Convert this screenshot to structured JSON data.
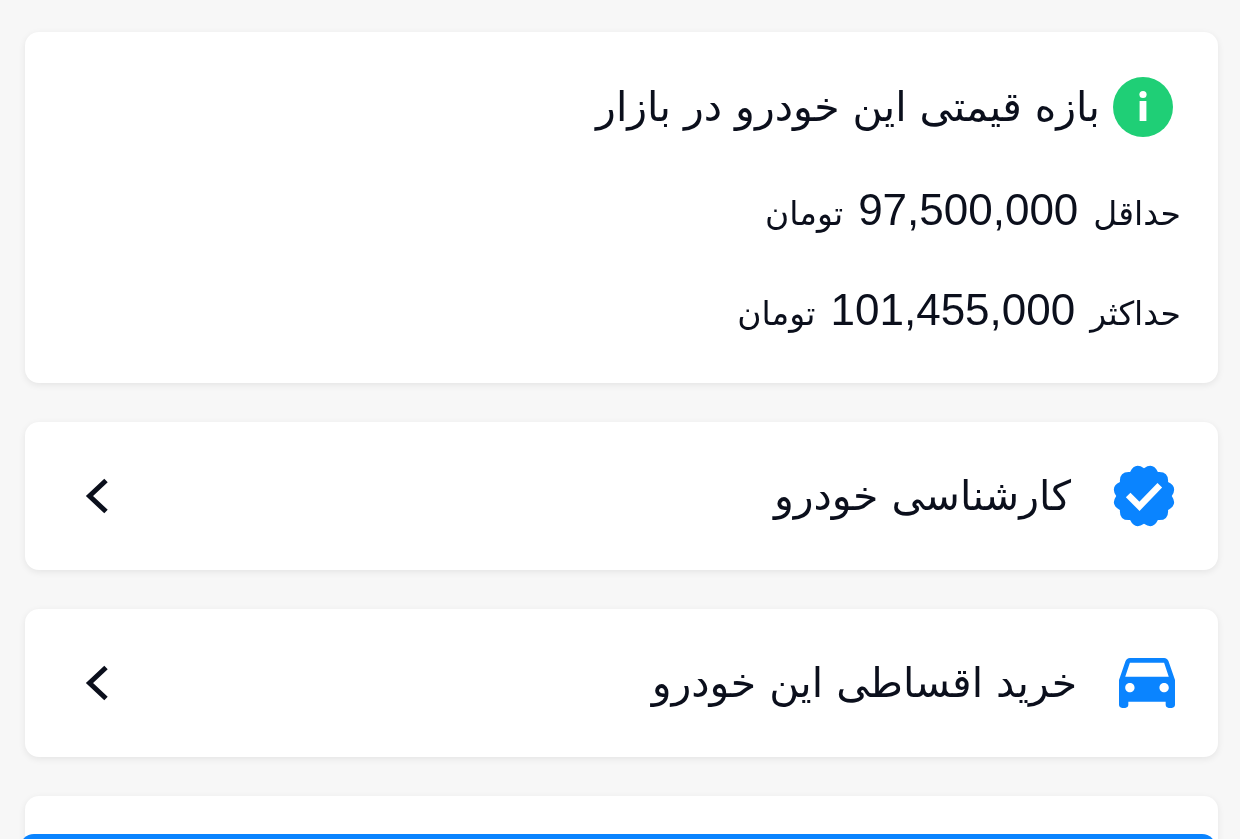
{
  "price_range_card": {
    "title": "بازه قیمتی این خودرو در بازار",
    "rows": [
      {
        "label": "حداقل",
        "amount": "97,500,000",
        "unit": "تومان"
      },
      {
        "label": "حداکثر",
        "amount": "101,455,000",
        "unit": "تومان"
      }
    ]
  },
  "menu_items": [
    {
      "kind": "inspection",
      "label": "کارشناسی خودرو"
    },
    {
      "kind": "installment",
      "label": "خرید اقساطی این خودرو"
    }
  ]
}
